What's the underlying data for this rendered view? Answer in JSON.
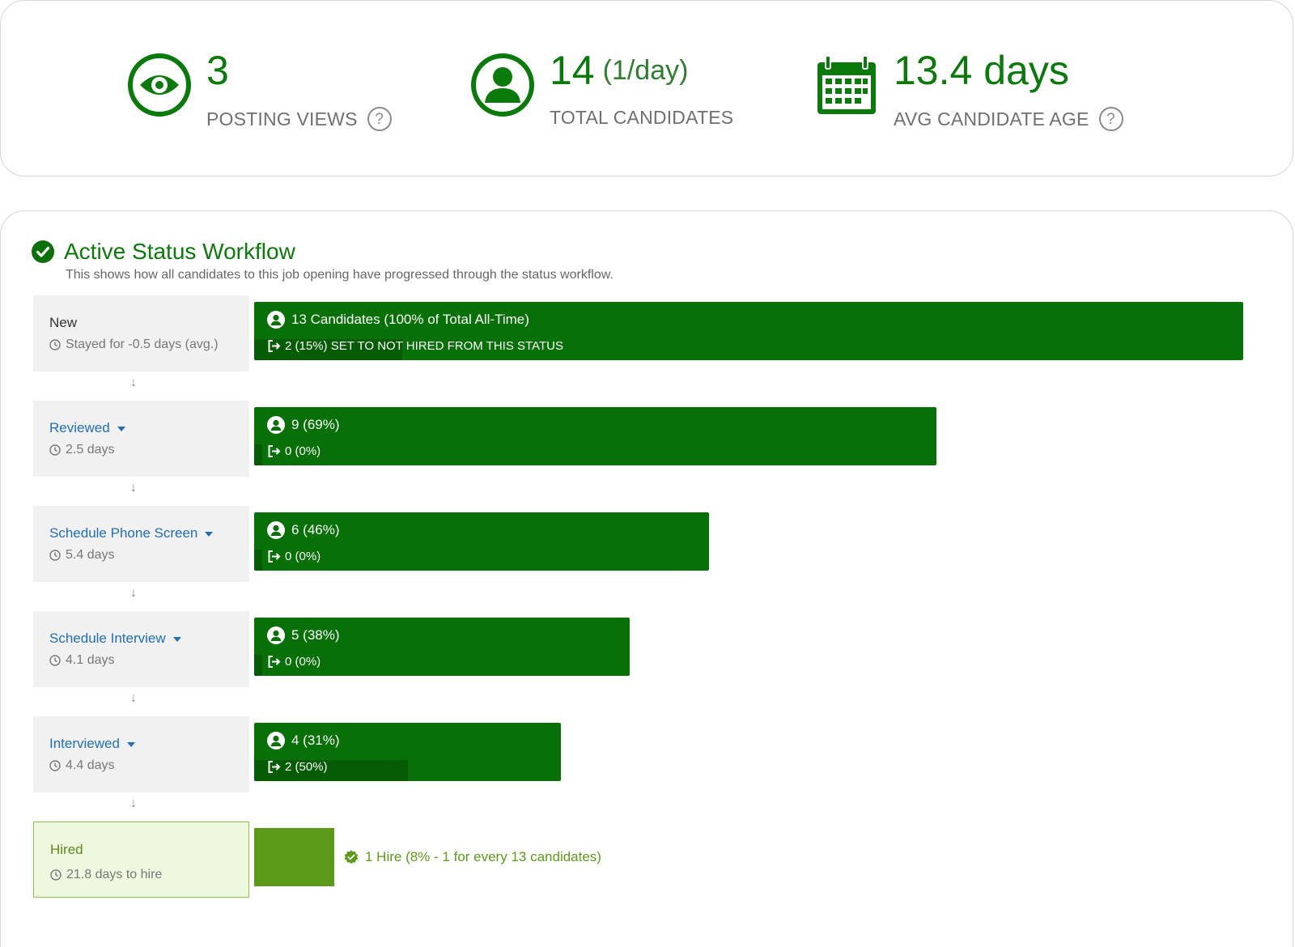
{
  "stats": {
    "views": {
      "value": "3",
      "label": "POSTING VIEWS",
      "help": "?"
    },
    "candidates": {
      "value": "14",
      "rate": "(1/day)",
      "label": "TOTAL CANDIDATES"
    },
    "age": {
      "value": "13.4 days",
      "label": "AVG CANDIDATE AGE",
      "help": "?"
    }
  },
  "workflow": {
    "title": "Active Status Workflow",
    "description": "This shows how all candidates to this job opening have progressed through the status workflow.",
    "arrow": "↓",
    "statuses": [
      {
        "name": "New",
        "duration": "Stayed for -0.5 days (avg.)",
        "count_label": "13 Candidates (100% of Total All-Time)",
        "not_hired_label": "2 (15%) SET TO NOT HIRED FROM THIS STATUS",
        "share": 1.0,
        "not_hired_share": 0.15
      },
      {
        "name": "Reviewed",
        "duration": "2.5 days",
        "count_label": "9 (69%)",
        "not_hired_label": "0 (0%)",
        "share": 0.69,
        "not_hired_share": 0.0
      },
      {
        "name": "Schedule Phone Screen",
        "duration": "5.4 days",
        "count_label": "6 (46%)",
        "not_hired_label": "0 (0%)",
        "share": 0.46,
        "not_hired_share": 0.0
      },
      {
        "name": "Schedule Interview",
        "duration": "4.1 days",
        "count_label": "5 (38%)",
        "not_hired_label": "0 (0%)",
        "share": 0.38,
        "not_hired_share": 0.0
      },
      {
        "name": "Interviewed",
        "duration": "4.4 days",
        "count_label": "4 (31%)",
        "not_hired_label": "2 (50%)",
        "share": 0.31,
        "not_hired_share": 0.5
      }
    ],
    "hired": {
      "name": "Hired",
      "duration": "21.8 days to hire",
      "summary": "1 Hire (8% - 1 for every 13 candidates)",
      "share": 0.08
    }
  },
  "colors": {
    "brand_green": "#077007",
    "hired_green": "#5b9a19",
    "link_blue": "#1f6fb5"
  },
  "icons": {
    "views": "eye-icon",
    "candidates": "user-circle-icon",
    "age": "calendar-icon",
    "title": "check-circle-icon",
    "status_dropdown": "caret-down-icon",
    "duration": "clock-icon",
    "count": "user-circle-icon",
    "not_hired": "exit-icon",
    "hire": "badge-check-icon"
  }
}
